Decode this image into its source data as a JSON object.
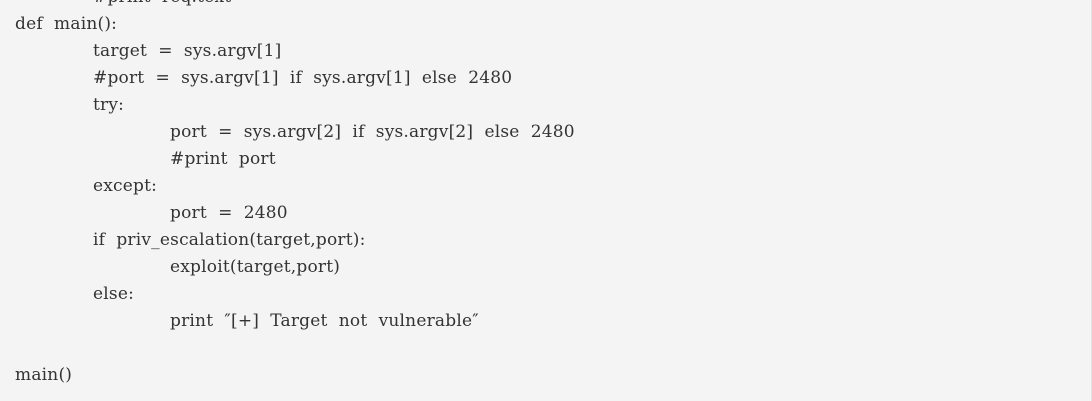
{
  "code": {
    "lines": [
      {
        "indent": 1,
        "text": "#print  req.text"
      },
      {
        "indent": 0,
        "text": "def  main():"
      },
      {
        "indent": 1,
        "text": "target  =  sys.argv[1]"
      },
      {
        "indent": 1,
        "text": "#port  =  sys.argv[1]  if  sys.argv[1]  else  2480"
      },
      {
        "indent": 1,
        "text": "try:"
      },
      {
        "indent": 2,
        "text": "port  =  sys.argv[2]  if  sys.argv[2]  else  2480"
      },
      {
        "indent": 2,
        "text": "#print  port"
      },
      {
        "indent": 1,
        "text": "except:"
      },
      {
        "indent": 2,
        "text": "port  =  2480"
      },
      {
        "indent": 1,
        "text": "if  priv_escalation(target,port):"
      },
      {
        "indent": 2,
        "text": "exploit(target,port)"
      },
      {
        "indent": 1,
        "text": "else:"
      },
      {
        "indent": 2,
        "text": "print  ″[+]  Target  not  vulnerable″"
      },
      {
        "indent": 0,
        "text": ""
      },
      {
        "indent": 0,
        "text": "main()"
      }
    ]
  }
}
